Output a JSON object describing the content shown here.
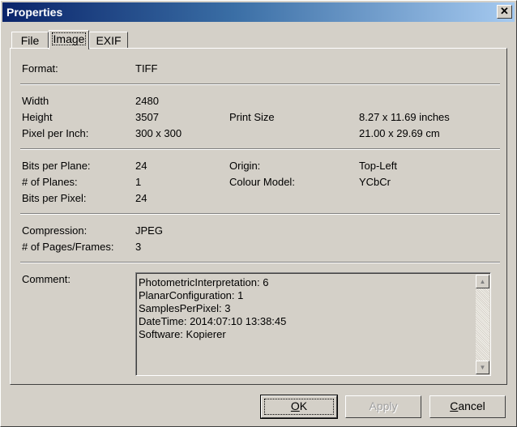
{
  "window": {
    "title": "Properties",
    "close_glyph": "✕"
  },
  "tabs": [
    "File",
    "Image",
    "EXIF"
  ],
  "fields": {
    "format": {
      "label": "Format:",
      "value": "TIFF"
    },
    "width": {
      "label": "Width",
      "value": "2480"
    },
    "height": {
      "label": "Height",
      "value": "3507"
    },
    "ppi": {
      "label": "Pixel per Inch:",
      "value": "300 x 300"
    },
    "print_size": {
      "label": "Print Size",
      "inches": "8.27 x 11.69 inches",
      "cm": "21.00 x 29.69 cm"
    },
    "bits_per_plane": {
      "label": "Bits per Plane:",
      "value": "24"
    },
    "num_planes": {
      "label": "# of Planes:",
      "value": "1"
    },
    "bits_per_pixel": {
      "label": "Bits per Pixel:",
      "value": "24"
    },
    "origin": {
      "label": "Origin:",
      "value": "Top-Left"
    },
    "colour_model": {
      "label": "Colour Model:",
      "value": "YCbCr"
    },
    "compression": {
      "label": "Compression:",
      "value": "JPEG"
    },
    "pages": {
      "label": "# of Pages/Frames:",
      "value": "3"
    },
    "comment": {
      "label": "Comment:"
    }
  },
  "comment_lines": [
    "PhotometricInterpretation: 6",
    "PlanarConfiguration: 1",
    "SamplesPerPixel: 3",
    "DateTime: 2014:07:10 13:38:45",
    "Software: Kopierer"
  ],
  "buttons": {
    "ok": {
      "pre": "",
      "mnemonic": "O",
      "post": "K"
    },
    "apply": {
      "label": "Apply"
    },
    "cancel": {
      "pre": "",
      "mnemonic": "C",
      "post": "ancel"
    }
  },
  "icons": {
    "scroll_up": "triangle-up-icon",
    "scroll_down": "triangle-down-icon"
  }
}
